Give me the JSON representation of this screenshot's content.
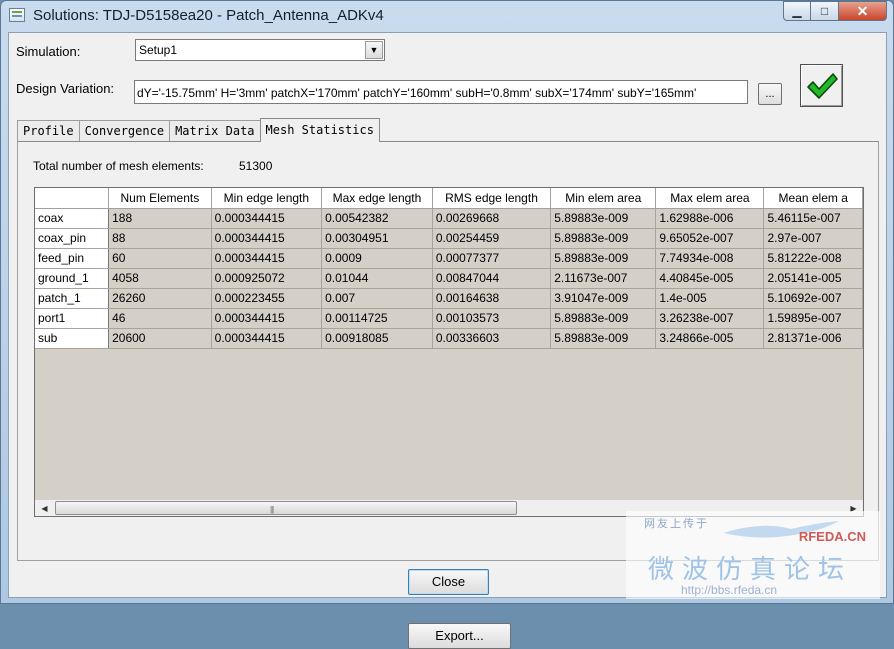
{
  "window": {
    "title": "Solutions: TDJ-D5158ea20 - Patch_Antenna_ADKv4",
    "minimize": "▁",
    "maximize": "□",
    "close": "✕"
  },
  "simulation": {
    "label": "Simulation:",
    "value": "Setup1"
  },
  "design_variation": {
    "label": "Design Variation:",
    "value": "dY='-15.75mm' H='3mm' patchX='170mm' patchY='160mm' subH='0.8mm' subX='174mm' subY='165mm'",
    "browse_label": "...",
    "status_icon": "green-check-icon"
  },
  "tabs": [
    "Profile",
    "Convergence",
    "Matrix Data",
    "Mesh Statistics"
  ],
  "active_tab": "Mesh Statistics",
  "mesh": {
    "total_label": "Total number of mesh elements:",
    "total_value": "51300",
    "columns": [
      "",
      "Num Elements",
      "Min edge length",
      "Max edge length",
      "RMS edge length",
      "Min elem area",
      "Max elem area",
      "Mean elem a"
    ],
    "rows": [
      [
        "coax",
        "188",
        "0.000344415",
        "0.00542382",
        "0.00269668",
        "5.89883e-009",
        "1.62988e-006",
        "5.46115e-007"
      ],
      [
        "coax_pin",
        "88",
        "0.000344415",
        "0.00304951",
        "0.00254459",
        "5.89883e-009",
        "9.65052e-007",
        "2.97e-007"
      ],
      [
        "feed_pin",
        "60",
        "0.000344415",
        "0.0009",
        "0.00077377",
        "5.89883e-009",
        "7.74934e-008",
        "5.81222e-008"
      ],
      [
        "ground_1",
        "4058",
        "0.000925072",
        "0.01044",
        "0.00847044",
        "2.11673e-007",
        "4.40845e-005",
        "2.05141e-005"
      ],
      [
        "patch_1",
        "26260",
        "0.000223455",
        "0.007",
        "0.00164638",
        "3.91047e-009",
        "1.4e-005",
        "5.10692e-007"
      ],
      [
        "port1",
        "46",
        "0.000344415",
        "0.00114725",
        "0.00103573",
        "5.89883e-009",
        "3.26238e-007",
        "1.59895e-007"
      ],
      [
        "sub",
        "20600",
        "0.000344415",
        "0.00918085",
        "0.00336603",
        "5.89883e-009",
        "3.24866e-005",
        "2.81371e-006"
      ]
    ]
  },
  "buttons": {
    "export": "Export...",
    "close": "Close"
  },
  "watermark": {
    "small": "网友上传于",
    "brand": "RFEDA.CN",
    "big": "微波仿真论坛",
    "url": "http://bbs.rfeda.cn"
  },
  "colors": {
    "grid_bg": "#d4d0c8",
    "check": "#22b322",
    "title_bar": "#b9d1ea"
  }
}
